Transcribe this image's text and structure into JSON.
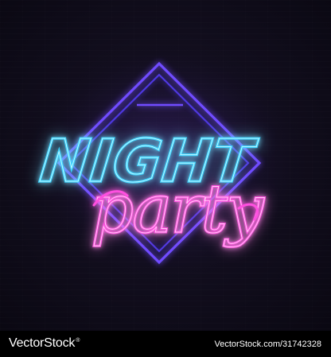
{
  "artwork": {
    "headline": "NIGHT",
    "script_word": "party",
    "colors": {
      "background": "#120e1e",
      "diamond_neon": "#5b3cff",
      "night_neon": "#27c8ff",
      "party_neon": "#ff3ed8"
    }
  },
  "footer": {
    "brand_logo": "VectorStock",
    "brand_mark": "®",
    "image_credit": "VectorStock.com/31742328"
  }
}
